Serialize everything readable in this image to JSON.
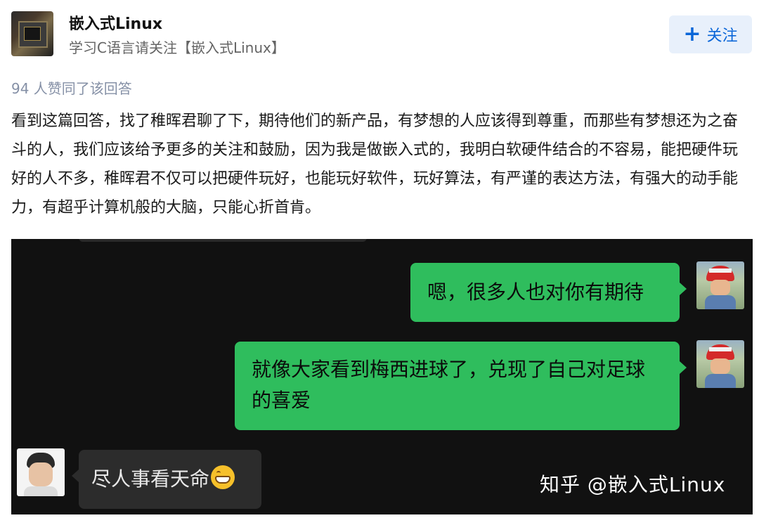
{
  "author": {
    "name": "嵌入式Linux",
    "bio": "学习C语言请关注【嵌入式Linux】",
    "follow_label": "关注",
    "follow_icon": "plus-icon"
  },
  "answer": {
    "upvote_text": "94 人赞同了该回答",
    "paragraph": "看到这篇回答，找了稚晖君聊了下，期待他们的新产品，有梦想的人应该得到尊重，而那些有梦想还为之奋斗的人，我们应该给予更多的关注和鼓励，因为我是做嵌入式的，我明白软硬件结合的不容易，能把硬件玩好的人不多，稚晖君不仅可以把硬件玩好，也能玩好软件，玩好算法，有严谨的表达方法，有强大的动手能力，有超乎计算机般的大脑，只能心折首肯。"
  },
  "chat": {
    "messages": [
      {
        "side": "right",
        "text": "嗯，很多人也对你有期待"
      },
      {
        "side": "right",
        "text": "就像大家看到梅西进球了，兑现了自己对足球的喜爱"
      },
      {
        "side": "left",
        "text": "尽人事看天命",
        "emoji": "grinning-face-icon"
      }
    ],
    "watermark": "知乎 @嵌入式Linux"
  },
  "colors": {
    "accent": "#0a66d8",
    "follow_bg": "#e8f0fb",
    "chat_bg": "#111111",
    "bubble_green": "#2fbd5d",
    "bubble_dark": "#2c2c2c",
    "muted": "#8590a6"
  }
}
